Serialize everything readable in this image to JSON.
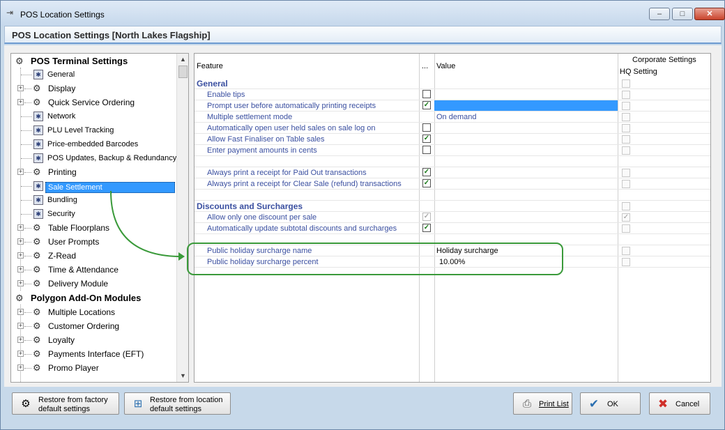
{
  "window": {
    "title": "POS Location Settings",
    "minimize_label": "–",
    "maximize_label": "□",
    "close_label": "✕"
  },
  "header": {
    "title": "POS Location Settings  [North Lakes Flagship]"
  },
  "tree": {
    "root": "POS Terminal Settings",
    "items": [
      {
        "label": "General",
        "expandable": false,
        "icon": "settings-small-icon"
      },
      {
        "label": "Display",
        "expandable": true,
        "icon": "gears-icon"
      },
      {
        "label": "Quick Service Ordering",
        "expandable": true,
        "icon": "gears-icon"
      },
      {
        "label": "Network",
        "expandable": false,
        "icon": "settings-small-icon"
      },
      {
        "label": "PLU Level Tracking",
        "expandable": false,
        "icon": "settings-small-icon"
      },
      {
        "label": "Price-embedded Barcodes",
        "expandable": false,
        "icon": "settings-small-icon"
      },
      {
        "label": "POS Updates, Backup & Redundancy",
        "expandable": false,
        "icon": "settings-small-icon"
      },
      {
        "label": "Printing",
        "expandable": true,
        "icon": "gears-icon"
      },
      {
        "label": "Sale Settlement",
        "expandable": false,
        "icon": "settings-small-icon",
        "selected": true
      },
      {
        "label": "Bundling",
        "expandable": false,
        "icon": "settings-small-icon"
      },
      {
        "label": "Security",
        "expandable": false,
        "icon": "settings-small-icon"
      },
      {
        "label": "Table Floorplans",
        "expandable": true,
        "icon": "gears-icon"
      },
      {
        "label": "User Prompts",
        "expandable": true,
        "icon": "gears-icon"
      },
      {
        "label": "Z-Read",
        "expandable": true,
        "icon": "gears-icon"
      },
      {
        "label": "Time & Attendance",
        "expandable": true,
        "icon": "gears-icon"
      },
      {
        "label": "Delivery Module",
        "expandable": true,
        "icon": "gears-icon"
      }
    ],
    "root2": "Polygon Add-On Modules",
    "items2": [
      {
        "label": "Multiple Locations"
      },
      {
        "label": "Customer Ordering"
      },
      {
        "label": "Loyalty"
      },
      {
        "label": "Payments Interface (EFT)"
      },
      {
        "label": "Promo Player"
      }
    ]
  },
  "grid": {
    "col_feature": "Feature",
    "col_dots": "...",
    "col_value": "Value",
    "col_corporate": "Corporate Settings",
    "col_hq": "HQ Setting",
    "groups": {
      "general": "General",
      "discounts": "Discounts and Surcharges"
    },
    "rows": {
      "enable_tips": "Enable tips",
      "prompt_user": "Prompt user before automatically printing receipts",
      "multiple_settlement": "Multiple settlement mode",
      "multiple_settlement_value": "On demand",
      "auto_open": "Automatically open user held sales on sale log on",
      "fast_finaliser": "Allow Fast Finaliser on Table sales",
      "payment_cents": "Enter payment amounts in cents",
      "paid_out": "Always print a receipt for Paid Out transactions",
      "clear_sale": "Always print a receipt for Clear Sale (refund) transactions",
      "one_discount": "Allow only one discount per sale",
      "auto_update": "Automatically update subtotal discounts and surcharges",
      "holiday_name": "Public holiday surcharge name",
      "holiday_name_value": "Holiday surcharge",
      "holiday_percent": "Public holiday surcharge percent",
      "holiday_percent_value": "10.00%"
    },
    "check_mark": "✓"
  },
  "buttons": {
    "restore_factory_line1": "Restore from factory",
    "restore_factory_line2": "default settings",
    "restore_location_line1": "Restore from location",
    "restore_location_line2": "default settings",
    "print_list": "Print List",
    "ok": "OK",
    "cancel": "Cancel"
  },
  "colors": {
    "selection": "#3399ff",
    "callout": "#3a9a3a",
    "link_text": "#3a4fa0"
  }
}
